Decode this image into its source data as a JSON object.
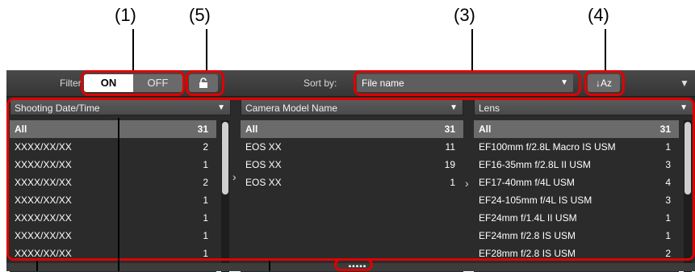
{
  "callout_numbers": [
    "(1)",
    "(5)",
    "(3)",
    "(4)"
  ],
  "toolbar": {
    "filter_label": "Filter",
    "filter_on": "ON",
    "filter_off": "OFF",
    "lock_icon": "lock-icon",
    "sort_by_label": "Sort by:",
    "sort_value": "File name",
    "sort_order_label": "↓Az",
    "menu_icon": "dropdown-triangle-icon"
  },
  "columns": [
    {
      "header": "Shooting Date/Time",
      "rows": [
        {
          "label": "All",
          "count": "31"
        },
        {
          "label": "XXXX/XX/XX",
          "count": "2"
        },
        {
          "label": "XXXX/XX/XX",
          "count": "1"
        },
        {
          "label": "XXXX/XX/XX",
          "count": "2"
        },
        {
          "label": "XXXX/XX/XX",
          "count": "1"
        },
        {
          "label": "XXXX/XX/XX",
          "count": "1"
        },
        {
          "label": "XXXX/XX/XX",
          "count": "1"
        },
        {
          "label": "XXXX/XX/XX",
          "count": "1"
        }
      ]
    },
    {
      "header": "Camera Model Name",
      "rows": [
        {
          "label": "All",
          "count": "31"
        },
        {
          "label": "EOS XX",
          "count": "11"
        },
        {
          "label": "EOS XX",
          "count": "19"
        },
        {
          "label": "EOS XX",
          "count": "1"
        }
      ]
    },
    {
      "header": "Lens",
      "rows": [
        {
          "label": "All",
          "count": "31"
        },
        {
          "label": "EF100mm f/2.8L Macro IS USM",
          "count": "1"
        },
        {
          "label": "EF16-35mm f/2.8L II USM",
          "count": "3"
        },
        {
          "label": "EF17-40mm f/4L USM",
          "count": "4"
        },
        {
          "label": "EF24-105mm f/4L IS USM",
          "count": "3"
        },
        {
          "label": "EF24mm f/1.4L II USM",
          "count": "1"
        },
        {
          "label": "EF24mm f/2.8 IS USM",
          "count": "1"
        },
        {
          "label": "EF28mm f/2.8 IS USM",
          "count": "2"
        }
      ]
    }
  ],
  "bottom_grip": "▪▪▪▪▪",
  "colors": {
    "callout": "#e00000",
    "panel_bg": "#2b2b2b",
    "selected_row": "#6b6b6b"
  }
}
